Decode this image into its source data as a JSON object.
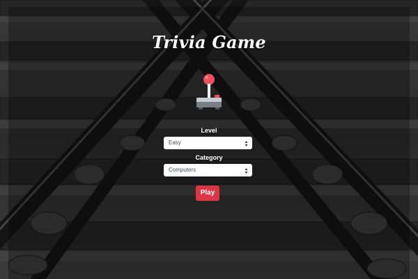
{
  "app": {
    "title": "Trivia Game"
  },
  "icons": {
    "logo": "joystick-icon",
    "select_caret": "sort-caret-icon"
  },
  "colors": {
    "play_button": "#dc3545",
    "text": "#ffffff",
    "joystick_ball": "#ef4f5b",
    "joystick_base": "#7a7f87"
  },
  "form": {
    "level": {
      "label": "Level",
      "selected": "Easy"
    },
    "category": {
      "label": "Category",
      "selected": "Computers"
    },
    "play_label": "Play"
  }
}
